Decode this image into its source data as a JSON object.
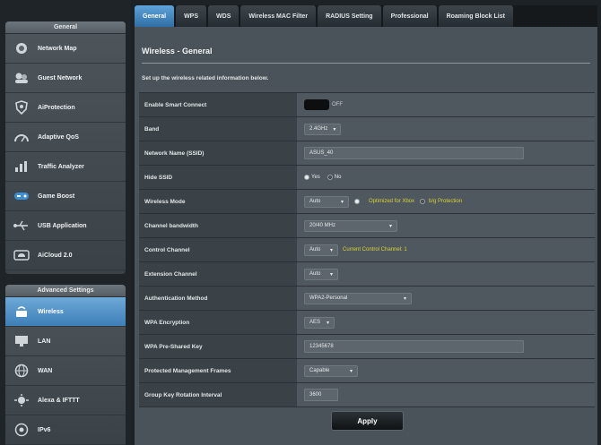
{
  "sidebar": {
    "general_header": "General",
    "general_items": [
      {
        "label": "Network Map",
        "icon": "network-map-icon"
      },
      {
        "label": "Guest Network",
        "icon": "guest-network-icon"
      },
      {
        "label": "AiProtection",
        "icon": "shield-icon"
      },
      {
        "label": "Adaptive QoS",
        "icon": "gauge-icon"
      },
      {
        "label": "Traffic Analyzer",
        "icon": "chart-icon"
      },
      {
        "label": "Game Boost",
        "icon": "game-icon"
      },
      {
        "label": "USB Application",
        "icon": "usb-icon"
      },
      {
        "label": "AiCloud 2.0",
        "icon": "cloud-icon"
      }
    ],
    "advanced_header": "Advanced Settings",
    "advanced_items": [
      {
        "label": "Wireless",
        "icon": "wireless-icon",
        "active": true
      },
      {
        "label": "LAN",
        "icon": "lan-icon"
      },
      {
        "label": "WAN",
        "icon": "globe-icon"
      },
      {
        "label": "Alexa & IFTTT",
        "icon": "alexa-icon"
      },
      {
        "label": "IPv6",
        "icon": "ipv6-icon"
      }
    ]
  },
  "tabs": [
    "General",
    "WPS",
    "WDS",
    "Wireless MAC Filter",
    "RADIUS Setting",
    "Professional",
    "Roaming Block List"
  ],
  "active_tab": 0,
  "page": {
    "title": "Wireless - General",
    "description": "Set up the wireless related information below."
  },
  "form": {
    "smart_connect": {
      "label": "Enable Smart Connect",
      "state": "OFF"
    },
    "band": {
      "label": "Band",
      "value": "2.4GHz"
    },
    "ssid": {
      "label": "Network Name (SSID)",
      "value": "ASUS_40"
    },
    "hide_ssid": {
      "label": "Hide SSID",
      "yes": "Yes",
      "no": "No"
    },
    "wireless_mode": {
      "label": "Wireless Mode",
      "value": "Auto",
      "opt1": "Optimized for Xbox",
      "opt2": "b/g Protection"
    },
    "bandwidth": {
      "label": "Channel bandwidth",
      "value": "20/40 MHz"
    },
    "control_channel": {
      "label": "Control Channel",
      "value": "Auto",
      "hint": "Current Control Channel: 1"
    },
    "extension_channel": {
      "label": "Extension Channel",
      "value": "Auto"
    },
    "auth_method": {
      "label": "Authentication Method",
      "value": "WPA2-Personal"
    },
    "wpa_encryption": {
      "label": "WPA Encryption",
      "value": "AES"
    },
    "wpa_key": {
      "label": "WPA Pre-Shared Key",
      "value": "12345678"
    },
    "pmf": {
      "label": "Protected Management Frames",
      "value": "Capable"
    },
    "group_key": {
      "label": "Group Key Rotation Interval",
      "value": "3600"
    }
  },
  "apply_label": "Apply",
  "colors": {
    "accent": "#3d7fb7",
    "hint": "#d9d23a"
  }
}
